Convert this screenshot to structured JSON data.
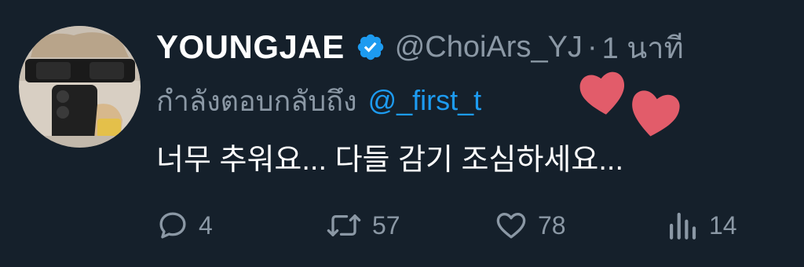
{
  "tweet": {
    "display_name": "YOUNGJAE",
    "handle": "@ChoiArs_YJ",
    "separator": "·",
    "time": "1 นาที",
    "reply_prefix": "กำลังตอบกลับถึง",
    "reply_to": "@_first_t",
    "text": "너무 추워요... 다들 감기 조심하세요...",
    "verified": true
  },
  "actions": {
    "reply": {
      "icon": "reply-icon",
      "count": "4"
    },
    "retweet": {
      "icon": "retweet-icon",
      "count": "57"
    },
    "like": {
      "icon": "heart-icon",
      "count": "78"
    },
    "views": {
      "icon": "views-icon",
      "count": "14"
    }
  },
  "colors": {
    "background": "#15202b",
    "text": "#ffffff",
    "secondary": "#8b98a5",
    "accent": "#1d9bf0",
    "heart_sticker": "#e25c6a"
  }
}
